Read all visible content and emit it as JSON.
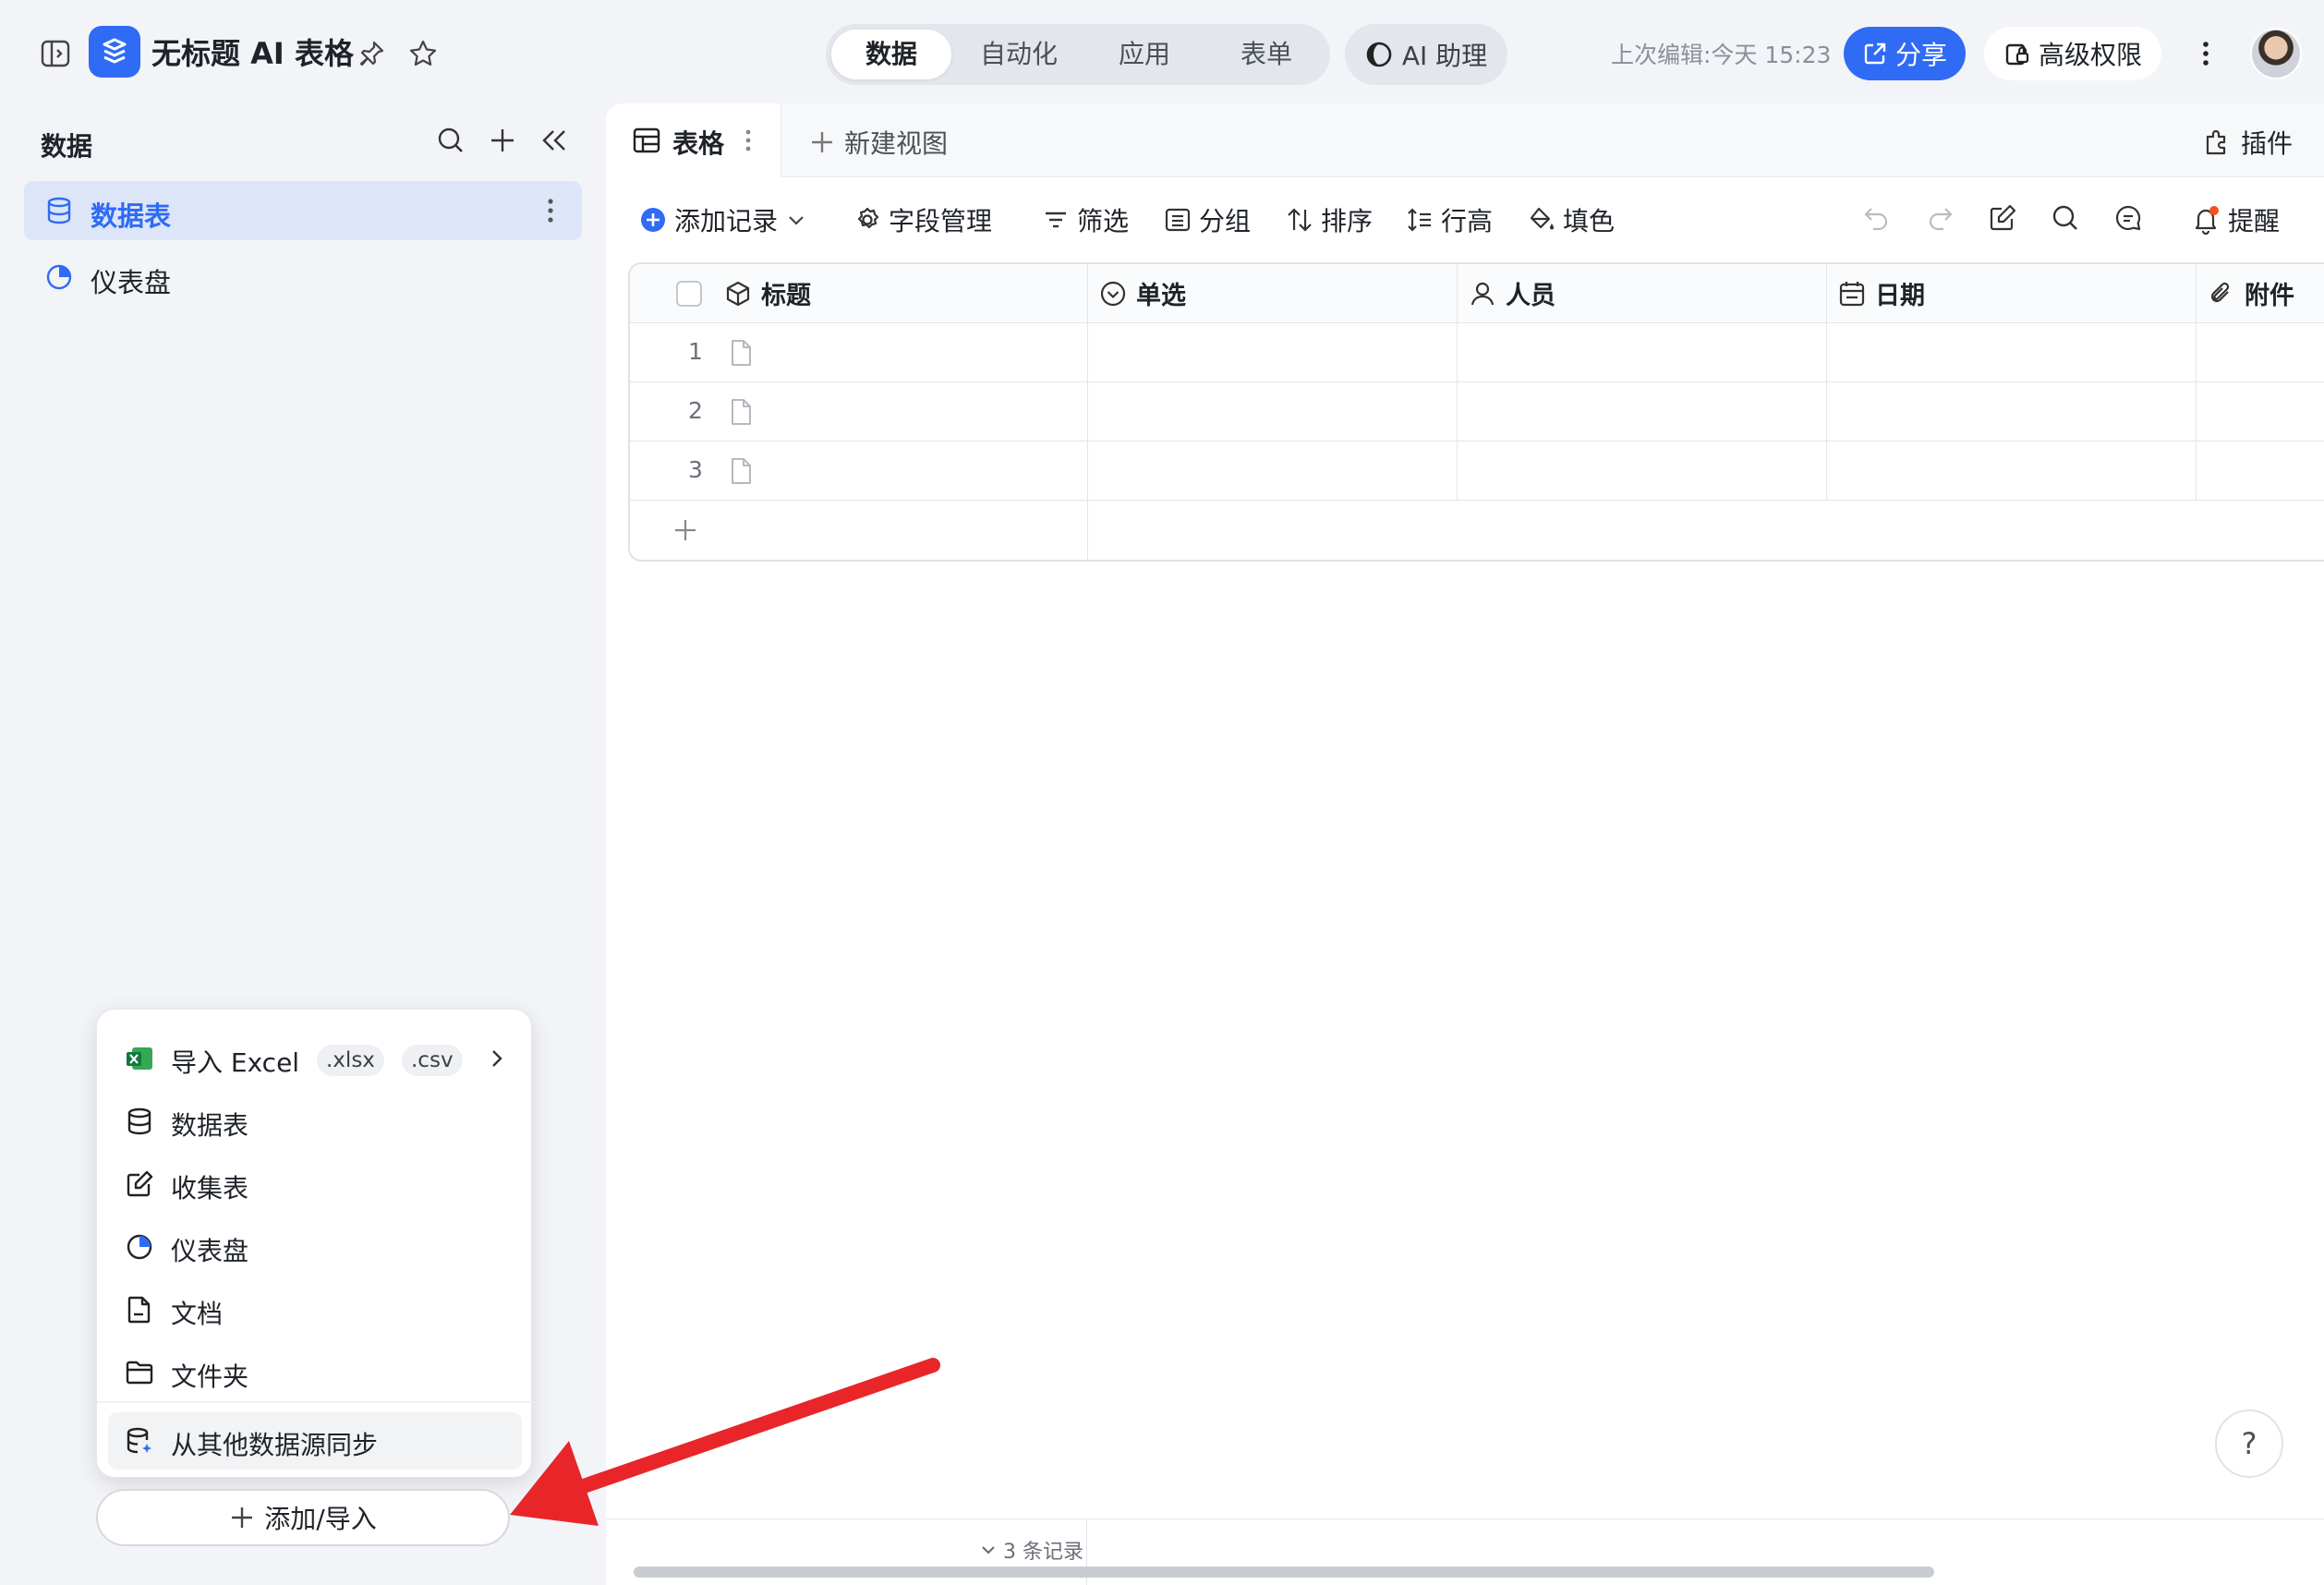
{
  "app": {
    "title": "无标题 AI 表格"
  },
  "top_tabs": [
    {
      "label": "数据",
      "active": true
    },
    {
      "label": "自动化",
      "active": false
    },
    {
      "label": "应用",
      "active": false
    },
    {
      "label": "表单",
      "active": false
    }
  ],
  "ai_assistant": {
    "label": "AI 助理"
  },
  "last_edit": "上次编辑:今天 15:23",
  "share": {
    "label": "分享"
  },
  "permissions": {
    "label": "高级权限"
  },
  "sidebar": {
    "title": "数据",
    "items": [
      {
        "label": "数据表",
        "active": true
      },
      {
        "label": "仪表盘",
        "active": false
      }
    ]
  },
  "view": {
    "current": "表格",
    "new_view": "新建视图",
    "plugins": "插件"
  },
  "toolbar": {
    "add_record": "添加记录",
    "fields": "字段管理",
    "filter": "筛选",
    "group": "分组",
    "sort": "排序",
    "row_height": "行高",
    "fill": "填色",
    "reminder": "提醒"
  },
  "grid": {
    "columns": [
      "标题",
      "单选",
      "人员",
      "日期",
      "附件"
    ],
    "rows": [
      "1",
      "2",
      "3"
    ]
  },
  "menu": {
    "import_excel": "导入 Excel",
    "ext_xlsx": ".xlsx",
    "ext_csv": ".csv",
    "items": [
      "数据表",
      "收集表",
      "仪表盘",
      "文档",
      "文件夹"
    ],
    "sync": "从其他数据源同步"
  },
  "add_import": "添加/导入",
  "footer": {
    "records": "3 条记录"
  },
  "help": "?",
  "colors": {
    "accent": "#2f6bf5",
    "arrow": "#e8262a",
    "selected_bg": "#dde6f8"
  }
}
